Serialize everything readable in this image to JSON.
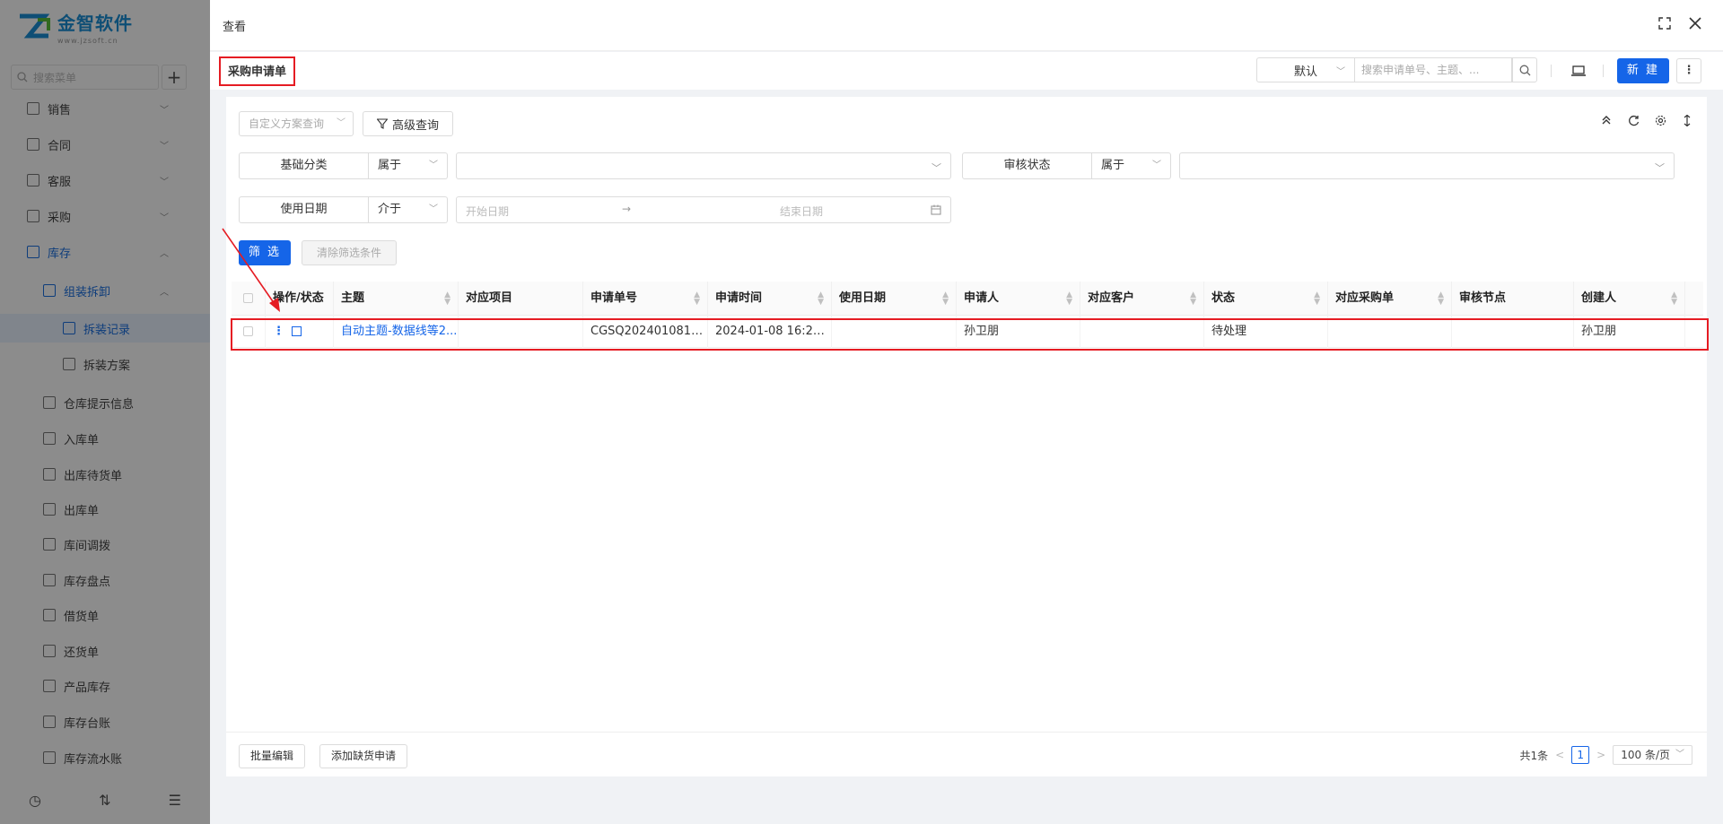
{
  "sidebar": {
    "logo_text": "金智软件",
    "logo_url": "www.jzsoft.cn",
    "search_placeholder": "搜索菜单",
    "items": [
      {
        "label": "销售"
      },
      {
        "label": "合同"
      },
      {
        "label": "客服"
      },
      {
        "label": "采购"
      },
      {
        "label": "库存"
      },
      {
        "label": "组装拆卸"
      },
      {
        "label": "拆装记录"
      },
      {
        "label": "拆装方案"
      },
      {
        "label": "仓库提示信息"
      },
      {
        "label": "入库单"
      },
      {
        "label": "出库待货单"
      },
      {
        "label": "出库单"
      },
      {
        "label": "库间调拨"
      },
      {
        "label": "库存盘点"
      },
      {
        "label": "借货单"
      },
      {
        "label": "还货单"
      },
      {
        "label": "产品库存"
      },
      {
        "label": "库存台账"
      },
      {
        "label": "库存流水账"
      }
    ]
  },
  "drawer": {
    "title": "查看"
  },
  "toolbar": {
    "tab_title": "采购申请单",
    "view_select": "默认",
    "search_placeholder": "搜索申请单号、主题、...",
    "new_label": "新 建"
  },
  "filters": {
    "scheme_placeholder": "自定义方案查询",
    "advanced_label": "高级查询",
    "row1": {
      "label1": "基础分类",
      "op1": "属于",
      "label2": "审核状态",
      "op2": "属于"
    },
    "row2": {
      "label": "使用日期",
      "op": "介于",
      "start_placeholder": "开始日期",
      "end_placeholder": "结束日期"
    },
    "filter_btn": "筛 选",
    "clear_btn": "清除筛选条件"
  },
  "table": {
    "columns": [
      "操作/状态",
      "主题",
      "对应项目",
      "申请单号",
      "申请时间",
      "使用日期",
      "申请人",
      "对应客户",
      "状态",
      "对应采购单",
      "审核节点",
      "创建人"
    ],
    "rows": [
      {
        "subject": "自动主题-数据线等2...",
        "project": "",
        "number": "CGSQ2024010810...",
        "time": "2024-01-08 16:25:...",
        "use_date": "",
        "applicant": "孙卫朋",
        "customer": "",
        "status": "待处理",
        "po": "",
        "node": "",
        "creator": "孙卫朋"
      }
    ]
  },
  "footer": {
    "batch_edit": "批量编辑",
    "add_shortage": "添加缺货申请",
    "total": "共1条",
    "page": "1",
    "page_size": "100 条/页"
  },
  "colors": {
    "primary": "#1565e8",
    "highlight": "#e51c23"
  }
}
